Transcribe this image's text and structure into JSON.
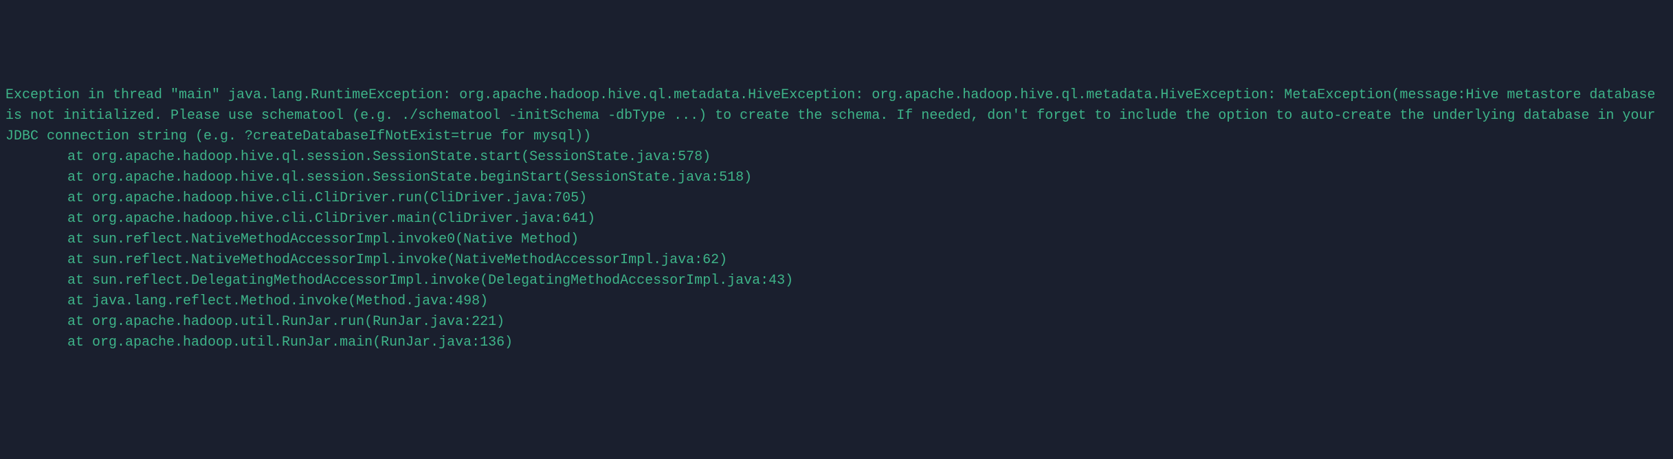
{
  "exception_header": "Exception in thread \"main\" java.lang.RuntimeException: org.apache.hadoop.hive.ql.metadata.HiveException: org.apache.hadoop.hive.ql.metadata.HiveException: MetaException(message:Hive metastore database is not initialized. Please use schematool (e.g. ./schematool -initSchema -dbType ...) to create the schema. If needed, don't forget to include the option to auto-create the underlying database in your JDBC connection string (e.g. ?createDatabaseIfNotExist=true for mysql))",
  "stack_frames": [
    "at org.apache.hadoop.hive.ql.session.SessionState.start(SessionState.java:578)",
    "at org.apache.hadoop.hive.ql.session.SessionState.beginStart(SessionState.java:518)",
    "at org.apache.hadoop.hive.cli.CliDriver.run(CliDriver.java:705)",
    "at org.apache.hadoop.hive.cli.CliDriver.main(CliDriver.java:641)",
    "at sun.reflect.NativeMethodAccessorImpl.invoke0(Native Method)",
    "at sun.reflect.NativeMethodAccessorImpl.invoke(NativeMethodAccessorImpl.java:62)",
    "at sun.reflect.DelegatingMethodAccessorImpl.invoke(DelegatingMethodAccessorImpl.java:43)",
    "at java.lang.reflect.Method.invoke(Method.java:498)",
    "at org.apache.hadoop.util.RunJar.run(RunJar.java:221)",
    "at org.apache.hadoop.util.RunJar.main(RunJar.java:136)"
  ]
}
